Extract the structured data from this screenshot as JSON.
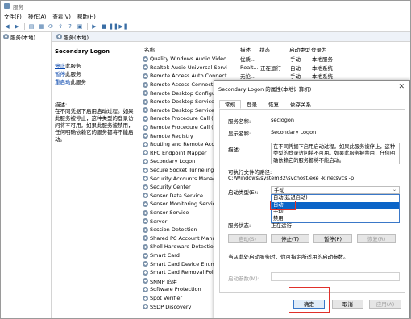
{
  "window": {
    "title": "服务"
  },
  "menu": [
    "文件(F)",
    "操作(A)",
    "查看(V)",
    "帮助(H)"
  ],
  "tree": {
    "item": "服务(本地)"
  },
  "header": {
    "label": "服务(本地)"
  },
  "desc_pane": {
    "title": "Secondary Logon",
    "links": [
      {
        "link": "停止",
        "rest": "此服务"
      },
      {
        "link": "暂停",
        "rest": "此服务"
      },
      {
        "link": "重启动",
        "rest": "此服务"
      }
    ],
    "label": "描述:",
    "text": "在不同凭据下启用启动过程。如果此服务被停止，这种类型的登录访问将不可用。如果此服务被禁用，任何明确依赖它的服务都将不能启动。"
  },
  "columns": {
    "name": "名称",
    "desc": "描述",
    "state": "状态",
    "start": "启动类型",
    "logon": "登录为"
  },
  "services": [
    {
      "name": "Quality Windows Audio Video Experi...",
      "desc": "优质...",
      "state": "",
      "start": "手动",
      "logon": "本地服务"
    },
    {
      "name": "Realtek Audio Universal Service",
      "desc": "Realt...",
      "state": "正在运行",
      "start": "自动",
      "logon": "本地系统"
    },
    {
      "name": "Remote Access Auto Connection Ma...",
      "desc": "无论...",
      "state": "",
      "start": "手动",
      "logon": "本地系统"
    },
    {
      "name": "Remote Access Connection",
      "desc": "",
      "state": "",
      "start": "",
      "logon": ""
    },
    {
      "name": "Remote Desktop Configurat",
      "desc": "",
      "state": "",
      "start": "",
      "logon": ""
    },
    {
      "name": "Remote Desktop Services",
      "desc": "",
      "state": "",
      "start": "",
      "logon": ""
    },
    {
      "name": "Remote Desktop Services U",
      "desc": "",
      "state": "",
      "start": "",
      "logon": ""
    },
    {
      "name": "Remote Procedure Call (RPC",
      "desc": "",
      "state": "",
      "start": "",
      "logon": ""
    },
    {
      "name": "Remote Procedure Call (RPC",
      "desc": "",
      "state": "",
      "start": "",
      "logon": ""
    },
    {
      "name": "Remote Registry",
      "desc": "",
      "state": "",
      "start": "",
      "logon": ""
    },
    {
      "name": "Routing and Remote Access",
      "desc": "",
      "state": "",
      "start": "",
      "logon": ""
    },
    {
      "name": "RPC Endpoint Mapper",
      "desc": "",
      "state": "",
      "start": "",
      "logon": ""
    },
    {
      "name": "Secondary Logon",
      "desc": "",
      "state": "",
      "start": "",
      "logon": ""
    },
    {
      "name": "Secure Socket Tunneling Pr",
      "desc": "",
      "state": "",
      "start": "",
      "logon": ""
    },
    {
      "name": "Security Accounts Manage",
      "desc": "",
      "state": "",
      "start": "",
      "logon": ""
    },
    {
      "name": "Security Center",
      "desc": "",
      "state": "",
      "start": "",
      "logon": ""
    },
    {
      "name": "Sensor Data Service",
      "desc": "",
      "state": "",
      "start": "",
      "logon": ""
    },
    {
      "name": "Sensor Monitoring Service",
      "desc": "",
      "state": "",
      "start": "",
      "logon": ""
    },
    {
      "name": "Sensor Service",
      "desc": "",
      "state": "",
      "start": "",
      "logon": ""
    },
    {
      "name": "Server",
      "desc": "",
      "state": "",
      "start": "",
      "logon": ""
    },
    {
      "name": "Session Detection",
      "desc": "",
      "state": "",
      "start": "",
      "logon": ""
    },
    {
      "name": "Shared PC Account Manager",
      "desc": "",
      "state": "",
      "start": "",
      "logon": ""
    },
    {
      "name": "Shell Hardware Detection",
      "desc": "",
      "state": "",
      "start": "",
      "logon": ""
    },
    {
      "name": "Smart Card",
      "desc": "",
      "state": "",
      "start": "",
      "logon": ""
    },
    {
      "name": "Smart Card Device Enumera",
      "desc": "",
      "state": "",
      "start": "",
      "logon": ""
    },
    {
      "name": "Smart Card Removal Policy",
      "desc": "",
      "state": "",
      "start": "",
      "logon": ""
    },
    {
      "name": "SNMP 陷阱",
      "desc": "",
      "state": "",
      "start": "",
      "logon": ""
    },
    {
      "name": "Software Protection",
      "desc": "",
      "state": "",
      "start": "",
      "logon": ""
    },
    {
      "name": "Spot Verifier",
      "desc": "",
      "state": "",
      "start": "",
      "logon": ""
    },
    {
      "name": "SSDP Discovery",
      "desc": "",
      "state": "",
      "start": "",
      "logon": ""
    }
  ],
  "dialog": {
    "title": "Secondary Logon 的属性(本地计算机)",
    "close": "✕",
    "tabs": [
      "常规",
      "登录",
      "恢复",
      "依存关系"
    ],
    "service_name_label": "服务名称:",
    "service_name": "seclogon",
    "display_name_label": "显示名称:",
    "display_name": "Secondary Logon",
    "desc_label": "描述:",
    "desc": "在不同凭据下启用启动过程。如果此服务被停止，这种类型的登录访问将不可用。如果此服务被禁用，任何明确依赖它的服务都将不能启动。",
    "path_label": "可执行文件的路径:",
    "path": "C:\\Windows\\system32\\svchost.exe -k netsvcs -p",
    "startup_label": "启动类型(E):",
    "startup_value": "手动",
    "startup_options": [
      "自动(延迟启动)",
      "自动",
      "手动",
      "禁用"
    ],
    "status_label": "服务状态:",
    "status_value": "正在运行",
    "btn_start": "启动(S)",
    "btn_stop": "停止(T)",
    "btn_pause": "暂停(P)",
    "btn_resume": "恢复(R)",
    "hint": "当从此处启动服务时，你可指定所适用的启动参数。",
    "param_label": "启动参数(M):",
    "ok": "确定",
    "cancel": "取消",
    "apply": "应用(A)"
  }
}
